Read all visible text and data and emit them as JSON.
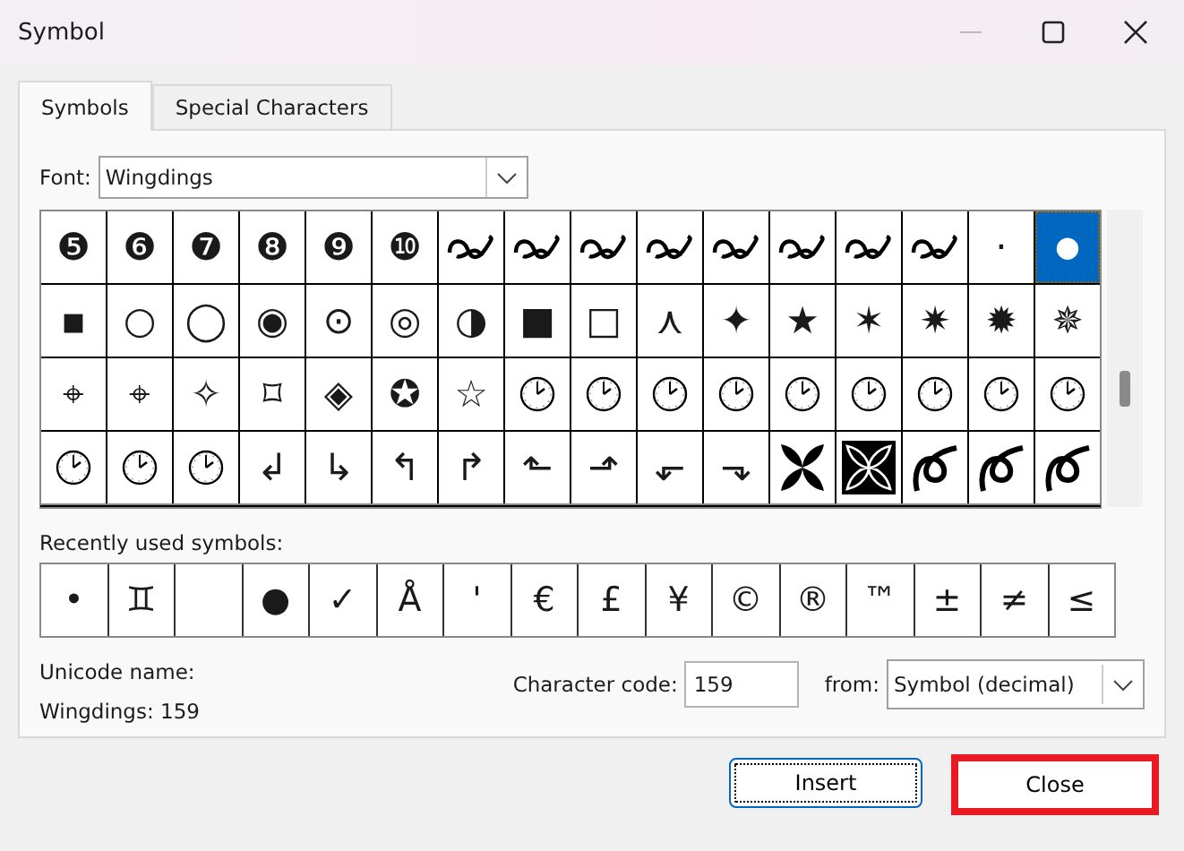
{
  "window": {
    "title": "Symbol"
  },
  "tabs": [
    {
      "label": "Symbols",
      "selected": true
    },
    {
      "label": "Special Characters",
      "selected": false
    }
  ],
  "font": {
    "label": "Font:",
    "value": "Wingdings"
  },
  "grid": [
    [
      {
        "kind": "char",
        "char": "❺",
        "selected": false
      },
      {
        "kind": "char",
        "char": "❻",
        "selected": false
      },
      {
        "kind": "char",
        "char": "❼",
        "selected": false
      },
      {
        "kind": "char",
        "char": "❽",
        "selected": false
      },
      {
        "kind": "char",
        "char": "❾",
        "selected": false
      },
      {
        "kind": "char",
        "char": "❿",
        "selected": false
      },
      {
        "kind": "flourish",
        "selected": false
      },
      {
        "kind": "flourish",
        "selected": false
      },
      {
        "kind": "flourish",
        "selected": false
      },
      {
        "kind": "flourish",
        "selected": false
      },
      {
        "kind": "flourish",
        "selected": false
      },
      {
        "kind": "flourish",
        "selected": false
      },
      {
        "kind": "flourish",
        "selected": false
      },
      {
        "kind": "flourish",
        "selected": false
      },
      {
        "kind": "char",
        "char": "·",
        "selected": false
      },
      {
        "kind": "char",
        "char": "●",
        "selected": true
      }
    ],
    [
      {
        "kind": "char",
        "char": "▪",
        "selected": false
      },
      {
        "kind": "char",
        "char": "○",
        "selected": false
      },
      {
        "kind": "char",
        "char": "◯",
        "selected": false
      },
      {
        "kind": "char",
        "char": "◉",
        "selected": false
      },
      {
        "kind": "char",
        "char": "⊙",
        "selected": false
      },
      {
        "kind": "char",
        "char": "◎",
        "selected": false
      },
      {
        "kind": "char",
        "char": "◑",
        "selected": false
      },
      {
        "kind": "char",
        "char": "■",
        "selected": false
      },
      {
        "kind": "char",
        "char": "□",
        "selected": false
      },
      {
        "kind": "char",
        "char": "⋏",
        "selected": false
      },
      {
        "kind": "char",
        "char": "✦",
        "selected": false
      },
      {
        "kind": "char",
        "char": "★",
        "selected": false
      },
      {
        "kind": "char",
        "char": "✶",
        "selected": false
      },
      {
        "kind": "char",
        "char": "✷",
        "selected": false
      },
      {
        "kind": "char",
        "char": "✹",
        "selected": false
      },
      {
        "kind": "char",
        "char": "✵",
        "selected": false
      }
    ],
    [
      {
        "kind": "char",
        "char": "⌖",
        "selected": false
      },
      {
        "kind": "char",
        "char": "⌖",
        "selected": false
      },
      {
        "kind": "char",
        "char": "✧",
        "selected": false
      },
      {
        "kind": "char",
        "char": "⌑",
        "selected": false
      },
      {
        "kind": "char",
        "char": "◈",
        "selected": false
      },
      {
        "kind": "char",
        "char": "✪",
        "selected": false
      },
      {
        "kind": "char",
        "char": "☆",
        "selected": false
      },
      {
        "kind": "clock",
        "selected": false
      },
      {
        "kind": "clock",
        "selected": false
      },
      {
        "kind": "clock",
        "selected": false
      },
      {
        "kind": "clock",
        "selected": false
      },
      {
        "kind": "clock",
        "selected": false
      },
      {
        "kind": "clock",
        "selected": false
      },
      {
        "kind": "clock",
        "selected": false
      },
      {
        "kind": "clock",
        "selected": false
      },
      {
        "kind": "clock",
        "selected": false
      }
    ],
    [
      {
        "kind": "clock",
        "selected": false
      },
      {
        "kind": "clock",
        "selected": false
      },
      {
        "kind": "clock",
        "selected": false
      },
      {
        "kind": "char",
        "char": "↲",
        "selected": false
      },
      {
        "kind": "char",
        "char": "↳",
        "selected": false
      },
      {
        "kind": "char",
        "char": "↰",
        "selected": false
      },
      {
        "kind": "char",
        "char": "↱",
        "selected": false
      },
      {
        "kind": "char",
        "char": "⬑",
        "selected": false
      },
      {
        "kind": "char",
        "char": "⬏",
        "selected": false
      },
      {
        "kind": "char",
        "char": "⬐",
        "selected": false
      },
      {
        "kind": "char",
        "char": "⬎",
        "selected": false
      },
      {
        "kind": "leaf",
        "selected": false
      },
      {
        "kind": "leafbox",
        "selected": false
      },
      {
        "kind": "loop",
        "selected": false
      },
      {
        "kind": "loop",
        "selected": false
      },
      {
        "kind": "loop",
        "selected": false
      }
    ]
  ],
  "recent": {
    "label": "Recently used symbols:",
    "items": [
      {
        "kind": "char",
        "char": "•"
      },
      {
        "kind": "char",
        "char": "♊"
      },
      {
        "kind": "blank"
      },
      {
        "kind": "char",
        "char": "●"
      },
      {
        "kind": "char",
        "char": "✓"
      },
      {
        "kind": "char",
        "char": "Å"
      },
      {
        "kind": "char",
        "char": "'"
      },
      {
        "kind": "char",
        "char": "€"
      },
      {
        "kind": "char",
        "char": "£"
      },
      {
        "kind": "char",
        "char": "¥"
      },
      {
        "kind": "char",
        "char": "©"
      },
      {
        "kind": "char",
        "char": "®"
      },
      {
        "kind": "char",
        "char": "™"
      },
      {
        "kind": "char",
        "char": "±"
      },
      {
        "kind": "char",
        "char": "≠"
      },
      {
        "kind": "char",
        "char": "≤"
      }
    ]
  },
  "unicode_name": {
    "label": "Unicode name:",
    "value": "Wingdings: 159"
  },
  "character_code": {
    "label": "Character code:",
    "value": "159"
  },
  "from": {
    "label": "from:",
    "value": "Symbol (decimal)"
  },
  "buttons": [
    {
      "label": "Insert",
      "kind": "default"
    },
    {
      "label": "Close",
      "kind": "highlighted"
    }
  ]
}
